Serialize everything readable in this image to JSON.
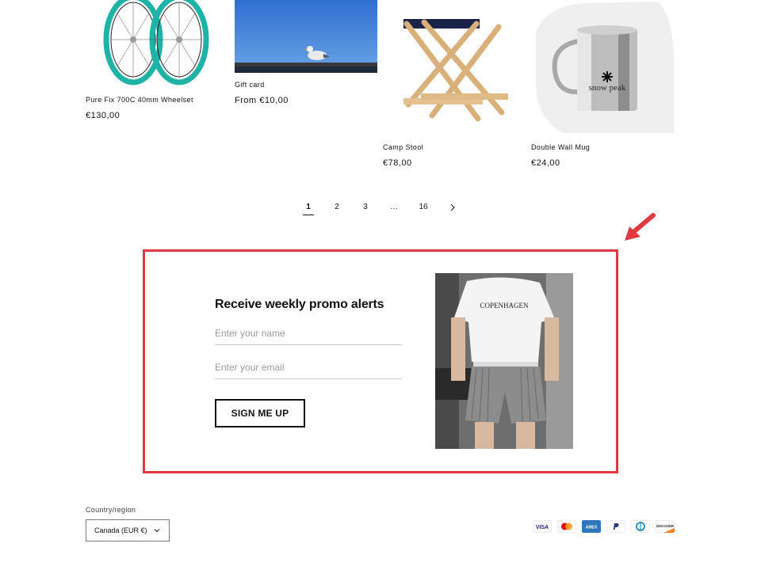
{
  "products": [
    {
      "title": "Pure Fix 700C 40mm Wheelset",
      "price": "€130,00"
    },
    {
      "title": "Gift card",
      "price": "From €10,00"
    },
    {
      "title": "Camp Stool",
      "price": "€78,00"
    },
    {
      "title": "Double Wall Mug",
      "price": "€24,00"
    }
  ],
  "pagination": {
    "pages": [
      "1",
      "2",
      "3",
      "…",
      "16"
    ],
    "current": "1",
    "next_icon": "chevron-right-icon"
  },
  "newsletter": {
    "title": "Receive weekly promo alerts",
    "name_placeholder": "Enter your name",
    "email_placeholder": "Enter your email",
    "button_label": "SIGN ME UP",
    "photo_text": "COPENHAGEN",
    "highlight_color": "#e0393e"
  },
  "mug_brand": "snow peak",
  "footer": {
    "country_label": "Country/region",
    "country_value": "Canada (EUR €)",
    "payment_methods": [
      "VISA",
      "Mastercard",
      "AMEX",
      "PayPal",
      "Diners Club",
      "DISCOVER"
    ]
  }
}
